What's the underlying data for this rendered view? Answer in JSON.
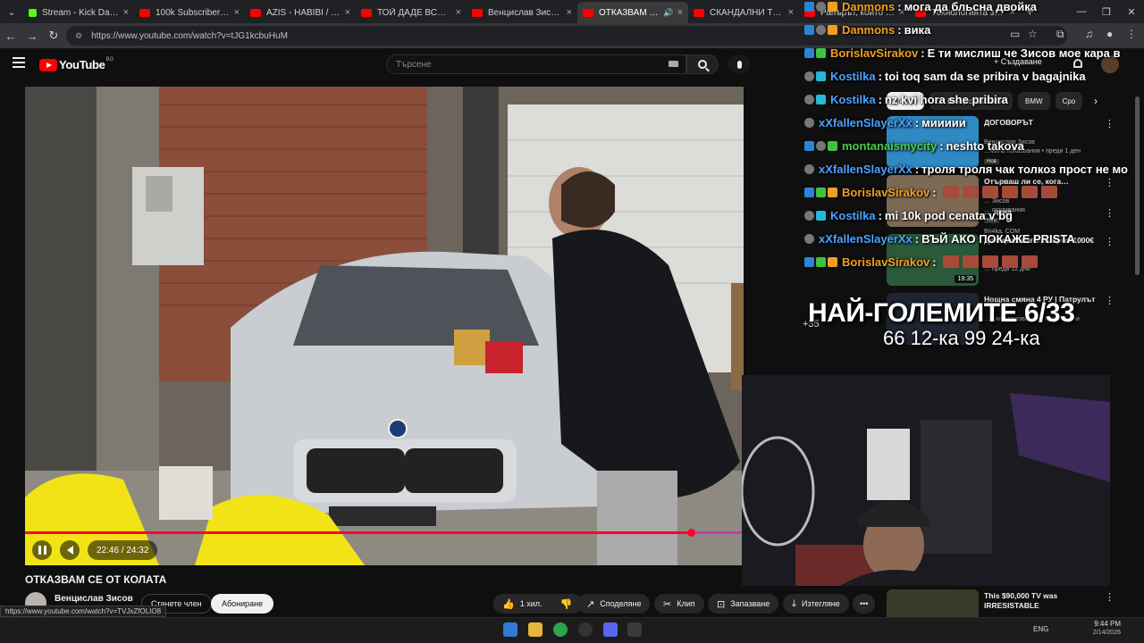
{
  "tabs": [
    {
      "title": "Stream - Kick Dashboar",
      "kind": "kick",
      "active": false
    },
    {
      "title": "100k Subscriber Special",
      "kind": "yt",
      "active": false
    },
    {
      "title": "AZIS - HABIBI / АЗИС -",
      "kind": "yt",
      "active": false
    },
    {
      "title": "ТОЙ ДАДЕ ВСИЧКИТЕ",
      "kind": "yt",
      "active": false
    },
    {
      "title": "Венцислав Зисов - You",
      "kind": "yt",
      "active": false
    },
    {
      "title": "ОТКАЗВАМ СЕ ОТ К",
      "kind": "yt",
      "active": true
    },
    {
      "title": "СКАНДАЛНИ ТИНДЪР",
      "kind": "yt",
      "active": false
    },
    {
      "title": "Рапърът, който кара е",
      "kind": "yt",
      "active": false
    },
    {
      "title": "Технологията зад LED",
      "kind": "yt",
      "active": false
    }
  ],
  "browser": {
    "url": "https://www.youtube.com/watch?v=tJG1kcbuHuM",
    "new_tab": "+",
    "win_min": "—",
    "win_max": "❐",
    "win_close": "✕"
  },
  "youtube": {
    "logo_text": "YouTube",
    "country_code": "BG",
    "search_placeholder": "Търсене",
    "create_label": "+ Създаване"
  },
  "player": {
    "current_time": "22:46 / 24:32",
    "progress_fraction": 0.927,
    "progress_color": "#ff0033"
  },
  "video": {
    "title": "ОТКАЗВАМ СЕ ОТ КОЛАТА",
    "channel": "Венцислав Зисов",
    "join_label": "Станете член",
    "subscribe_label": "Абониране",
    "likes_label": "1 хил.",
    "share_label": "Споделяне",
    "clip_label": "Клип",
    "save_label": "Запазване",
    "download_label": "Изтегляне",
    "more_label": "•••"
  },
  "status_url": "https://www.youtube.com/watch?v=TVJxZfOLIO8",
  "suggestions": {
    "chips": [
      "Всички",
      "От Венцислав Зисов",
      "BMW",
      "Сро"
    ],
    "items": [
      {
        "title": "ДОГОВОРЪТ",
        "channel": "Венцислав Зисов",
        "meta": "…мила показвания • преди 1 ден",
        "badge": "Нов",
        "duration": ""
      },
      {
        "title": "Отърваш ли се, кога…",
        "channel": "… Зисов",
        "meta": "… показвания",
        "badge": "Нов",
        "duration": ""
      },
      {
        "title": "… цена",
        "channel": "Bri4ka. COM",
        "meta": "… показвания • преди 10 часа",
        "badge": "",
        "duration": ""
      },
      {
        "title": "До Германия с Голф за 1000€",
        "channel": "…",
        "meta": "… преди 12 дни",
        "badge": "",
        "duration": "19:35"
      },
      {
        "title": "Нощна смяна 4 РУ | Патрулът",
        "channel": "… хил. показвания • преди 6 дни",
        "meta": "",
        "badge": "",
        "duration": ""
      },
      {
        "title": "This $90,000 TV was IRRESISTABLE",
        "channel": "",
        "meta": "",
        "badge": "",
        "duration": ""
      }
    ]
  },
  "chat": [
    {
      "badges": [
        "blue",
        "grey",
        "orange"
      ],
      "user": "Danmons",
      "color": "#f0a020",
      "msg": "могa да бльсна двойка"
    },
    {
      "badges": [
        "blue",
        "grey",
        "orange"
      ],
      "user": "Danmons",
      "color": "#f0a020",
      "msg": "вика"
    },
    {
      "badges": [
        "blue",
        "green"
      ],
      "user": "BorislavSirakov",
      "color": "#f0a020",
      "msg": "Е ти мислиш че Зисов мое кара в"
    },
    {
      "badges": [
        "grey",
        "cyan"
      ],
      "user": "Kostilka",
      "color": "#4aa3ff",
      "msg": "toi toq sam da se pribira v bagajnika"
    },
    {
      "badges": [
        "grey",
        "cyan"
      ],
      "user": "Kostilka",
      "color": "#4aa3ff",
      "msg": "nz kvi hora she pribira"
    },
    {
      "badges": [
        "grey"
      ],
      "user": "xXfallenSlayerXx",
      "color": "#4aa3ff",
      "msg": "миииии"
    },
    {
      "badges": [
        "blue",
        "grey",
        "green"
      ],
      "user": "montanaismycity",
      "color": "#4ccd4c",
      "msg": "neshto takova"
    },
    {
      "badges": [
        "grey"
      ],
      "user": "xXfallenSlayerXx",
      "color": "#4aa3ff",
      "msg": "троля троля чак толкоз прост не мо"
    },
    {
      "badges": [
        "blue",
        "green",
        "orange"
      ],
      "user": "BorislavSirakov",
      "color": "#f0a020",
      "msg": "",
      "emotes": 6
    },
    {
      "badges": [
        "grey",
        "cyan"
      ],
      "user": "Kostilka",
      "color": "#4aa3ff",
      "msg": "mi 10k pod cenata v bg"
    },
    {
      "badges": [
        "grey"
      ],
      "user": "xXfallenSlayerXx",
      "color": "#4aa3ff",
      "msg": "ВЪЙ АКО ПОКАЖЕ PRISTA"
    },
    {
      "badges": [
        "blue",
        "green",
        "orange"
      ],
      "user": "BorislavSirakov",
      "color": "#f0a020",
      "msg": "",
      "emotes": 5
    }
  ],
  "overlay": {
    "counter_title": "НАЙ-ГОЛЕМИТЕ 6/33",
    "counter_sub": "66 12-ка 99 24-ка",
    "plus_label": "+35"
  },
  "taskbar": {
    "lang": "ENG",
    "time": "9:44 PM",
    "date": "2/14/2026"
  }
}
